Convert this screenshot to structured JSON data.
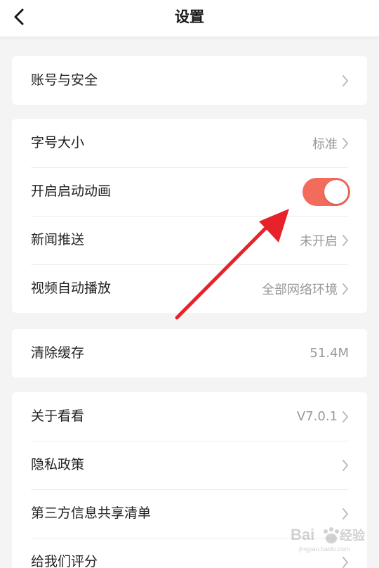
{
  "header": {
    "title": "设置",
    "back_icon": "chevron-left-icon"
  },
  "groups": [
    {
      "rows": [
        {
          "label": "账号与安全",
          "value": "",
          "control": "chevron"
        }
      ]
    },
    {
      "rows": [
        {
          "label": "字号大小",
          "value": "标准",
          "control": "chevron"
        },
        {
          "label": "开启启动动画",
          "value": "",
          "control": "toggle",
          "toggle_on": true
        },
        {
          "label": "新闻推送",
          "value": "未开启",
          "control": "chevron"
        },
        {
          "label": "视频自动播放",
          "value": "全部网络环境",
          "control": "chevron"
        }
      ]
    },
    {
      "rows": [
        {
          "label": "清除缓存",
          "value": "51.4M",
          "control": "none"
        }
      ]
    },
    {
      "rows": [
        {
          "label": "关于看看",
          "value": "V7.0.1",
          "control": "chevron"
        },
        {
          "label": "隐私政策",
          "value": "",
          "control": "chevron"
        },
        {
          "label": "第三方信息共享清单",
          "value": "",
          "control": "chevron"
        },
        {
          "label": "给我们评分",
          "value": "",
          "control": "chevron"
        }
      ]
    }
  ],
  "colors": {
    "toggle_on": "#f26b5b",
    "annotation_arrow": "#e8222a",
    "background": "#f4f4f4"
  },
  "watermark": {
    "brand": "Bai 经验",
    "url": "jingyan.baidu.com"
  }
}
